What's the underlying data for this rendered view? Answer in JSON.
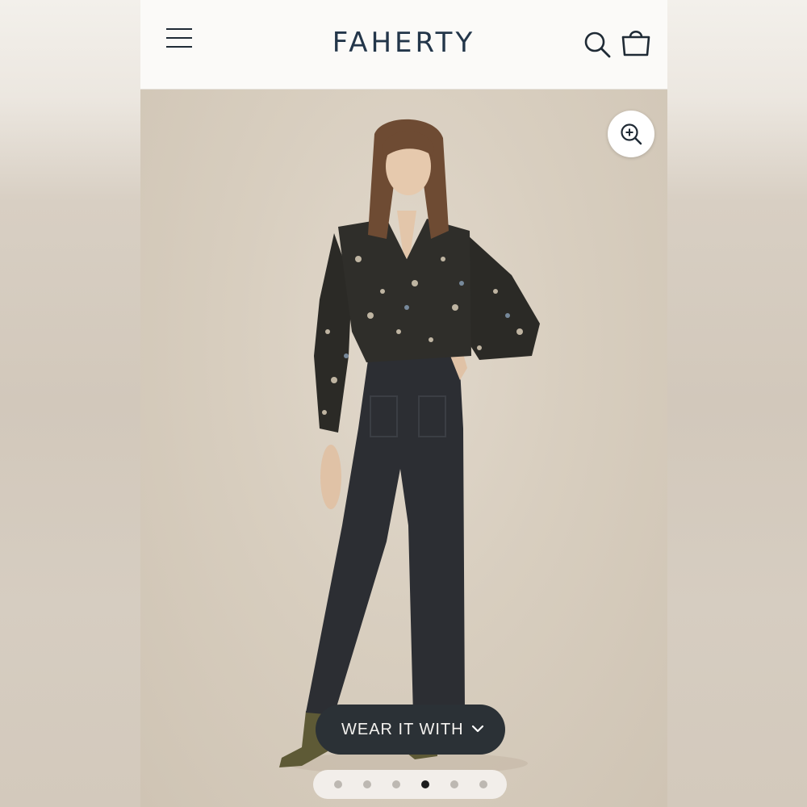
{
  "header": {
    "brand": "FAHERTY",
    "menu_icon": "hamburger-menu-icon",
    "search_icon": "search-icon",
    "cart_icon": "shopping-bag-icon"
  },
  "product_image": {
    "zoom_icon": "zoom-in-icon",
    "description": "Model wearing floral print blouse and dark wide-leg trousers"
  },
  "wear_it_with": {
    "label": "WEAR IT WITH",
    "icon": "chevron-down-icon"
  },
  "carousel": {
    "total": 6,
    "active_index": 3
  },
  "colors": {
    "brand_text": "#23364a",
    "button_bg": "#2b3136",
    "active_dot": "#1c1c1c"
  }
}
